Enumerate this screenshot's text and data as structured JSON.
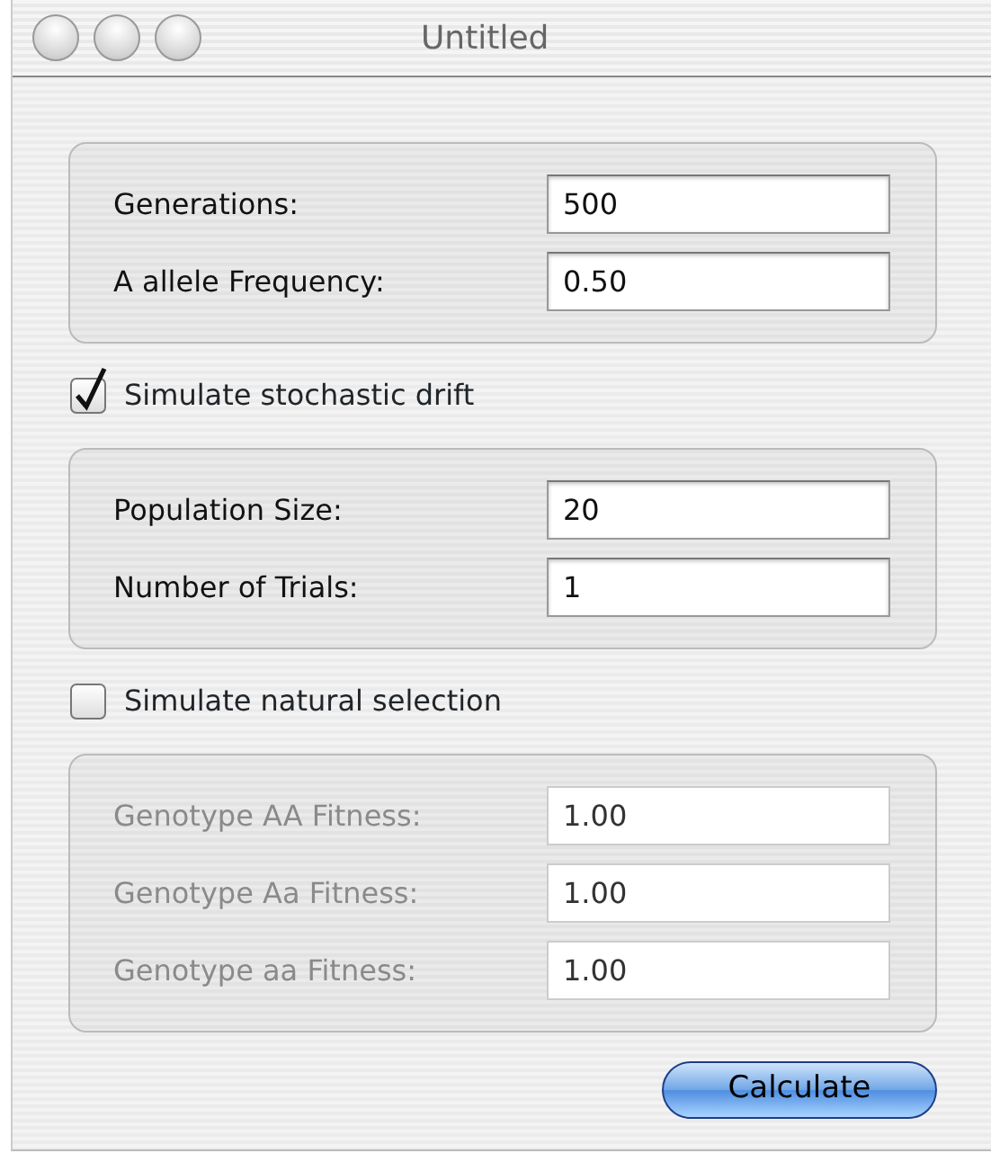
{
  "window": {
    "title": "Untitled"
  },
  "sections": [
    {
      "fields": [
        {
          "label": "Generations:",
          "value": "500",
          "disabled": false
        },
        {
          "label": "A allele Frequency:",
          "value": "0.50",
          "disabled": false
        }
      ]
    },
    {
      "toggle": {
        "label": "Simulate stochastic drift",
        "checked": true
      },
      "fields": [
        {
          "label": "Population Size:",
          "value": "20",
          "disabled": false
        },
        {
          "label": "Number of Trials:",
          "value": "1",
          "disabled": false
        }
      ]
    },
    {
      "toggle": {
        "label": "Simulate natural selection",
        "checked": false
      },
      "fields": [
        {
          "label": "Genotype AA Fitness:",
          "value": "1.00",
          "disabled": true
        },
        {
          "label": "Genotype Aa Fitness:",
          "value": "1.00",
          "disabled": true
        },
        {
          "label": "Genotype aa Fitness:",
          "value": "1.00",
          "disabled": true
        }
      ]
    }
  ],
  "button": "Calculate"
}
